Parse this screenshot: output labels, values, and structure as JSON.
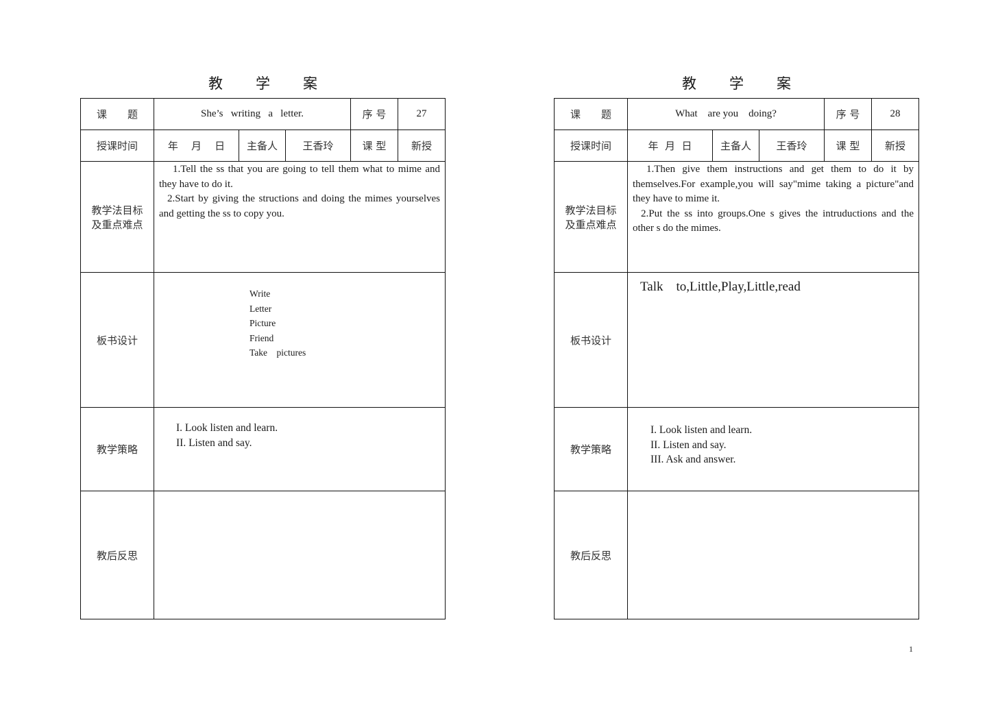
{
  "page_number": "1",
  "sheets": [
    {
      "title_chars": [
        "教",
        "学",
        "案"
      ],
      "labels": {
        "topic": "课　　题",
        "serial": "序 号",
        "time": "授课时间",
        "preparer": "主备人",
        "lesson_type": "课 型",
        "objectives": [
          "教学法目标",
          "及重点难点"
        ],
        "board": "板书设计",
        "strategy": "教学策略",
        "reflection": "教后反思"
      },
      "topic": "She’s   writing   a   letter.",
      "serial_no": "27",
      "date": "年    月    日",
      "preparer_name": "王香玲",
      "lesson_type_value": "新授",
      "objectives": [
        "1.Tell the ss that you are going to tell them what to mime and they have to do it.",
        "2.Start by giving the structions and doing the mimes yourselves and getting the ss to copy you."
      ],
      "board": [
        "Write",
        "Letter",
        "Picture",
        "Friend",
        "Take    pictures"
      ],
      "strategy": [
        "I. Look listen and learn.",
        "II. Listen and say."
      ],
      "reflection": ""
    },
    {
      "title_chars": [
        "教",
        "学",
        "案"
      ],
      "labels": {
        "topic": "课　　题",
        "serial": "序 号",
        "time": "授课时间",
        "preparer": "主备人",
        "lesson_type": "课 型",
        "objectives": [
          "教学法目标",
          "及重点难点"
        ],
        "board": "板书设计",
        "strategy": "教学策略",
        "reflection": "教后反思"
      },
      "topic": "What    are you    doing?",
      "serial_no": "28",
      "date": "年  月  日",
      "preparer_name": "王香玲",
      "lesson_type_value": "新授",
      "objectives": [
        "1.Then give them instructions and get them to do it by themselves.For example,you will say\"mime taking a picture\"and they have to mime it.",
        "2.Put the ss into groups.One s gives the intruductions and the other s do the mimes."
      ],
      "board": [
        "Talk    to,Little,Play,Little,read"
      ],
      "strategy": [
        "I. Look listen and learn.",
        "II. Listen and say.",
        "III. Ask and answer."
      ],
      "reflection": ""
    }
  ]
}
